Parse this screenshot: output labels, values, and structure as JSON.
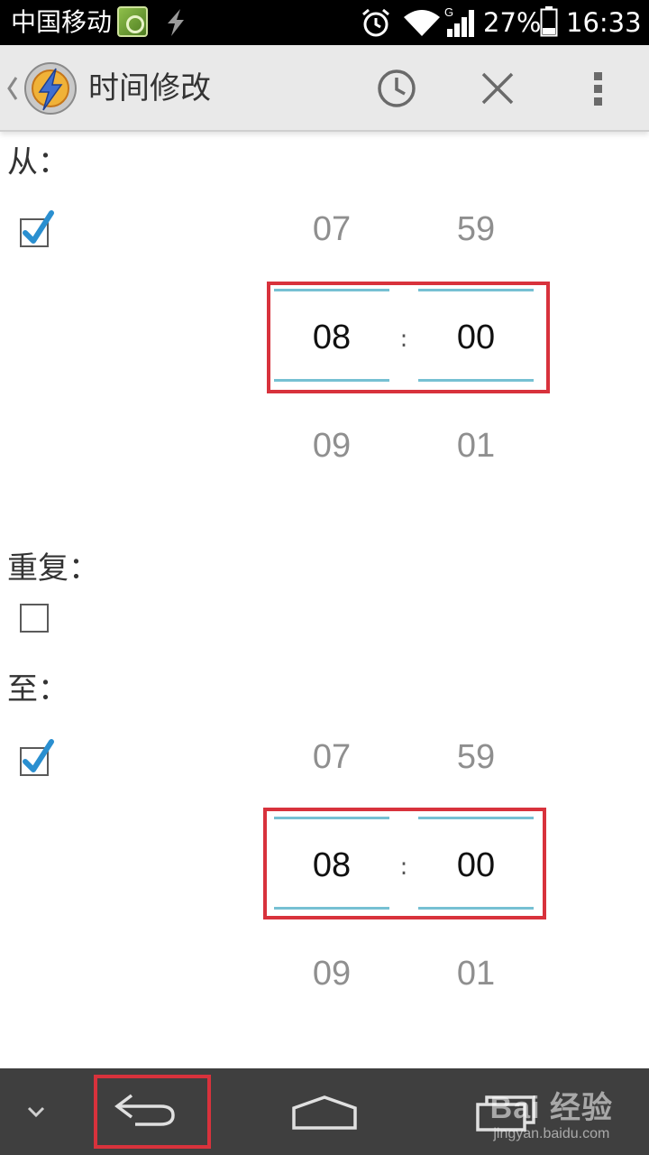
{
  "status_bar": {
    "carrier": "中国移动",
    "battery_percent": "27%",
    "time": "16:33",
    "network_type": "G",
    "icons": [
      "app-notification-icon",
      "lightning-icon",
      "alarm-icon",
      "wifi-icon",
      "cell-signal-icon",
      "battery-icon"
    ]
  },
  "action_bar": {
    "title": "时间修改",
    "icons": [
      "back-chevron-icon",
      "app-icon",
      "clock-icon",
      "close-icon",
      "overflow-menu-icon"
    ]
  },
  "from": {
    "label": "从：",
    "enabled": true,
    "hour": {
      "prev": "07",
      "value": "08",
      "next": "09"
    },
    "minute": {
      "prev": "59",
      "value": "00",
      "next": "01"
    },
    "separator": ":"
  },
  "repeat": {
    "label": "重复：",
    "enabled": false
  },
  "to": {
    "label": "至：",
    "enabled": true,
    "hour": {
      "prev": "07",
      "value": "08",
      "next": "09"
    },
    "minute": {
      "prev": "59",
      "value": "00",
      "next": "01"
    },
    "separator": ":"
  },
  "nav_bar": {
    "icons": [
      "hide-keyboard-icon",
      "back-icon",
      "home-icon",
      "recent-apps-icon"
    ],
    "watermark": {
      "main": "Bai  经验",
      "sub": "jingyan.baidu.com"
    }
  },
  "colors": {
    "accent_line": "#76c0d3",
    "highlight_box": "#d8323c",
    "check": "#2a8fd0",
    "action_bar_bg": "#e9e9e9",
    "nav_bar_bg": "#3f3f3f"
  }
}
